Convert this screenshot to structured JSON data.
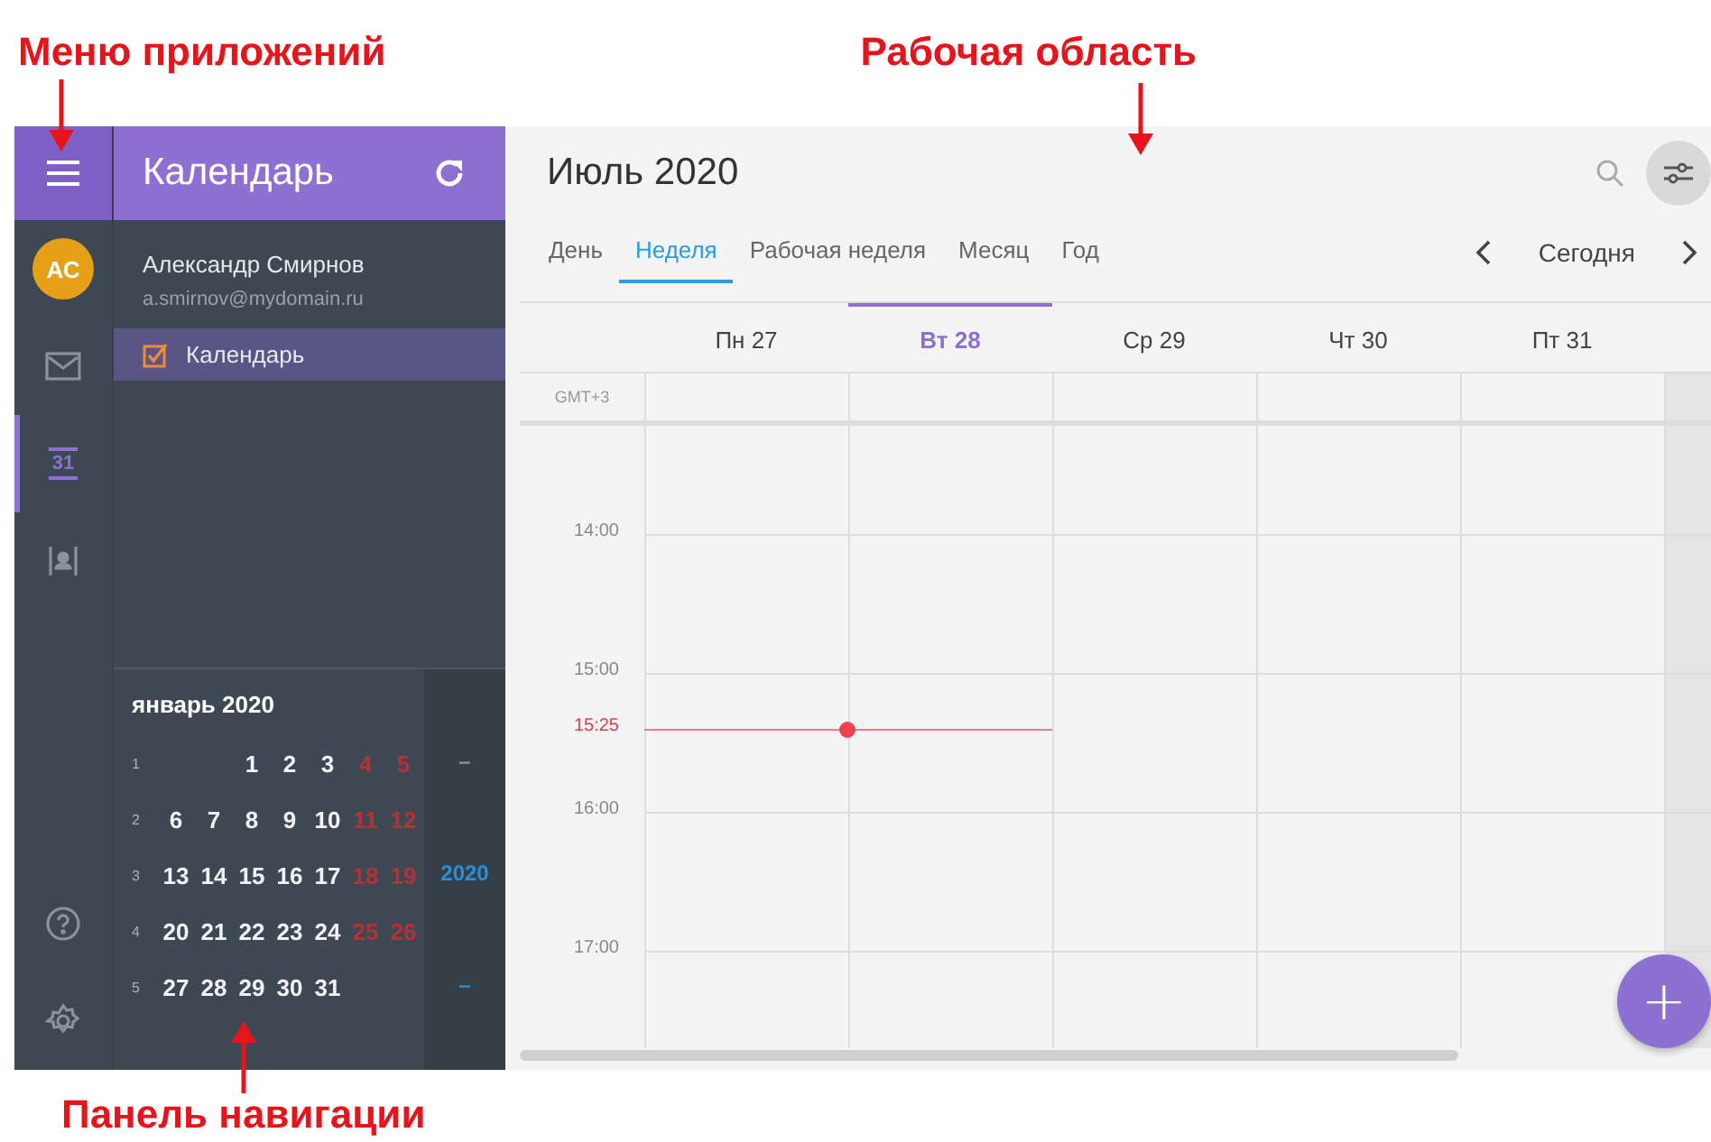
{
  "annotations": {
    "app_menu": "Меню приложений",
    "workspace": "Рабочая область",
    "nav_panel": "Панель навигации"
  },
  "app_header": {
    "title": "Календарь"
  },
  "rail": [
    {
      "kind": "avatar",
      "text": "АС"
    },
    {
      "kind": "mail",
      "selected": false
    },
    {
      "kind": "calendar",
      "text": "31",
      "selected": true
    },
    {
      "kind": "contacts",
      "selected": false
    },
    {
      "kind": "help",
      "selected": false
    },
    {
      "kind": "settings",
      "selected": false
    }
  ],
  "account": {
    "name": "Александр Смирнов",
    "email": "a.smirnov@mydomain.ru"
  },
  "calendars": [
    {
      "label": "Календарь",
      "checked": true,
      "selected": true
    }
  ],
  "mini_calendar": {
    "title": "январь 2020",
    "weeks": [
      {
        "number": "1",
        "days": [
          {
            "text": "1",
            "weekend": false
          },
          {
            "text": "2",
            "weekend": false
          },
          {
            "text": "3",
            "weekend": false
          },
          {
            "text": "4",
            "weekend": true
          },
          {
            "text": "5",
            "weekend": true
          }
        ]
      },
      {
        "number": "2",
        "days": [
          {
            "text": "6",
            "weekend": false
          },
          {
            "text": "7",
            "weekend": false
          },
          {
            "text": "8",
            "weekend": false
          },
          {
            "text": "9",
            "weekend": false
          },
          {
            "text": "10",
            "weekend": false
          },
          {
            "text": "11",
            "weekend": true
          },
          {
            "text": "12",
            "weekend": true
          }
        ]
      },
      {
        "number": "3",
        "days": [
          {
            "text": "13",
            "weekend": false
          },
          {
            "text": "14",
            "weekend": false
          },
          {
            "text": "15",
            "weekend": false
          },
          {
            "text": "16",
            "weekend": false
          },
          {
            "text": "17",
            "weekend": false
          },
          {
            "text": "18",
            "weekend": true
          },
          {
            "text": "19",
            "weekend": true
          }
        ]
      },
      {
        "number": "4",
        "days": [
          {
            "text": "20",
            "weekend": false
          },
          {
            "text": "21",
            "weekend": false
          },
          {
            "text": "22",
            "weekend": false
          },
          {
            "text": "23",
            "weekend": false
          },
          {
            "text": "24",
            "weekend": false
          },
          {
            "text": "25",
            "weekend": true
          },
          {
            "text": "26",
            "weekend": true
          }
        ]
      },
      {
        "number": "5",
        "days": [
          {
            "text": "27",
            "weekend": false
          },
          {
            "text": "28",
            "weekend": false
          },
          {
            "text": "29",
            "weekend": false
          },
          {
            "text": "30",
            "weekend": false
          },
          {
            "text": "31",
            "weekend": false
          }
        ]
      }
    ],
    "years": [
      {
        "kind": "previous",
        "text": "–"
      },
      {
        "kind": "year",
        "text": "2020"
      },
      {
        "kind": "next",
        "text": "–"
      }
    ]
  },
  "main": {
    "title": "Июль 2020",
    "views": [
      {
        "label": "День",
        "selected": false
      },
      {
        "label": "Неделя",
        "selected": true
      },
      {
        "label": "Рабочая неделя",
        "selected": false
      },
      {
        "label": "Месяц",
        "selected": false
      },
      {
        "label": "Год",
        "selected": false
      }
    ],
    "today": "Сегодня",
    "days": [
      {
        "label": "Пн 27",
        "selected": false
      },
      {
        "label": "Вт 28",
        "selected": true
      },
      {
        "label": "Ср 29",
        "selected": false
      },
      {
        "label": "Чт 30",
        "selected": false
      },
      {
        "label": "Пт 31",
        "selected": false
      }
    ],
    "timezone": "GMT+3",
    "hours": [
      "14:00",
      "15:00",
      "16:00",
      "17:00"
    ],
    "now": "15:25",
    "add_button": "+"
  }
}
